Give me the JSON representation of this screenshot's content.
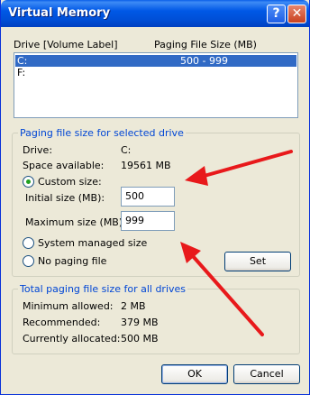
{
  "window": {
    "title": "Virtual Memory"
  },
  "titlebar": {
    "help_glyph": "?",
    "close_glyph": "✕"
  },
  "list": {
    "header_drive": "Drive  [Volume Label]",
    "header_size": "Paging File Size (MB)",
    "rows": [
      {
        "drive": "C:",
        "size": "500 - 999",
        "selected": true
      },
      {
        "drive": "F:",
        "size": "",
        "selected": false
      }
    ]
  },
  "selected": {
    "legend": "Paging file size for selected drive",
    "drive_label": "Drive:",
    "drive_value": "C:",
    "space_label": "Space available:",
    "space_value": "19561 MB",
    "custom_label": "Custom size:",
    "initial_label": "Initial size (MB):",
    "initial_value": "500",
    "max_label": "Maximum size (MB):",
    "max_value": "999",
    "system_label": "System managed size",
    "nopaging_label": "No paging file",
    "set_label": "Set",
    "selected_option": "custom"
  },
  "total": {
    "legend": "Total paging file size for all drives",
    "min_label": "Minimum allowed:",
    "min_value": "2 MB",
    "rec_label": "Recommended:",
    "rec_value": "379 MB",
    "cur_label": "Currently allocated:",
    "cur_value": "500 MB"
  },
  "buttons": {
    "ok": "OK",
    "cancel": "Cancel"
  },
  "annotations": {
    "arrow_color": "#e8191b"
  }
}
